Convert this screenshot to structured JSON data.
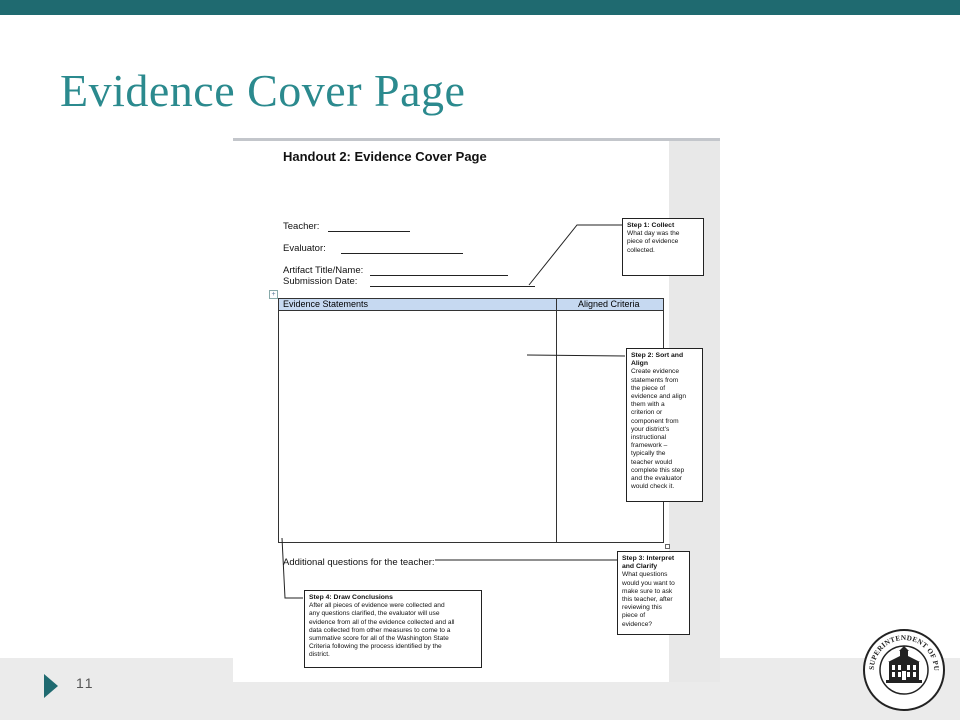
{
  "slide": {
    "title": "Evidence Cover Page",
    "page_number": "11",
    "accent_color": "#1f6a70",
    "title_color": "#2b8a8e"
  },
  "handout": {
    "heading": "Handout 2: Evidence Cover Page",
    "fields": {
      "teacher": "Teacher:",
      "evaluator": "Evaluator:",
      "artifact": "Artifact Title/Name:",
      "submission": "Submission Date:"
    },
    "table": {
      "columns": [
        "Evidence Statements",
        "Aligned Criteria"
      ],
      "header_color": "#c6d9f1"
    },
    "additional_questions": "Additional questions for the teacher:"
  },
  "callouts": {
    "step1": {
      "title": "Step 1: Collect",
      "lines": [
        "What day was the",
        "piece of evidence",
        "collected."
      ]
    },
    "step2": {
      "title_lines": [
        "Step 2: Sort and",
        "Align"
      ],
      "lines": [
        "Create evidence",
        "statements from",
        "the piece of",
        "evidence and align",
        "them with a",
        "criterion or",
        "component from",
        "your district's",
        "instructional",
        "framework –",
        "typically the",
        "teacher would",
        "complete this step",
        "and the evaluator",
        "would check it."
      ]
    },
    "step3": {
      "title_lines": [
        "Step 3: Interpret",
        "and Clarify"
      ],
      "lines": [
        "What questions",
        "would you want to",
        "make sure to ask",
        "this teacher, after",
        "reviewing this",
        "piece of",
        "evidence?"
      ]
    },
    "step4": {
      "title": "Step 4: Draw Conclusions",
      "lines": [
        "After all pieces of evidence were collected and",
        "any questions clarified, the evaluator will use",
        "evidence from all of the evidence collected and all",
        "data collected from other measures to come to a",
        "summative score for all of the Washington State",
        "Criteria following the process identified by the",
        "district."
      ]
    }
  },
  "seal": {
    "text": "SUPERINTENDENT OF PUBLIC INSTRUCTION · WASHINGTON",
    "icon": "building-seal-icon"
  }
}
